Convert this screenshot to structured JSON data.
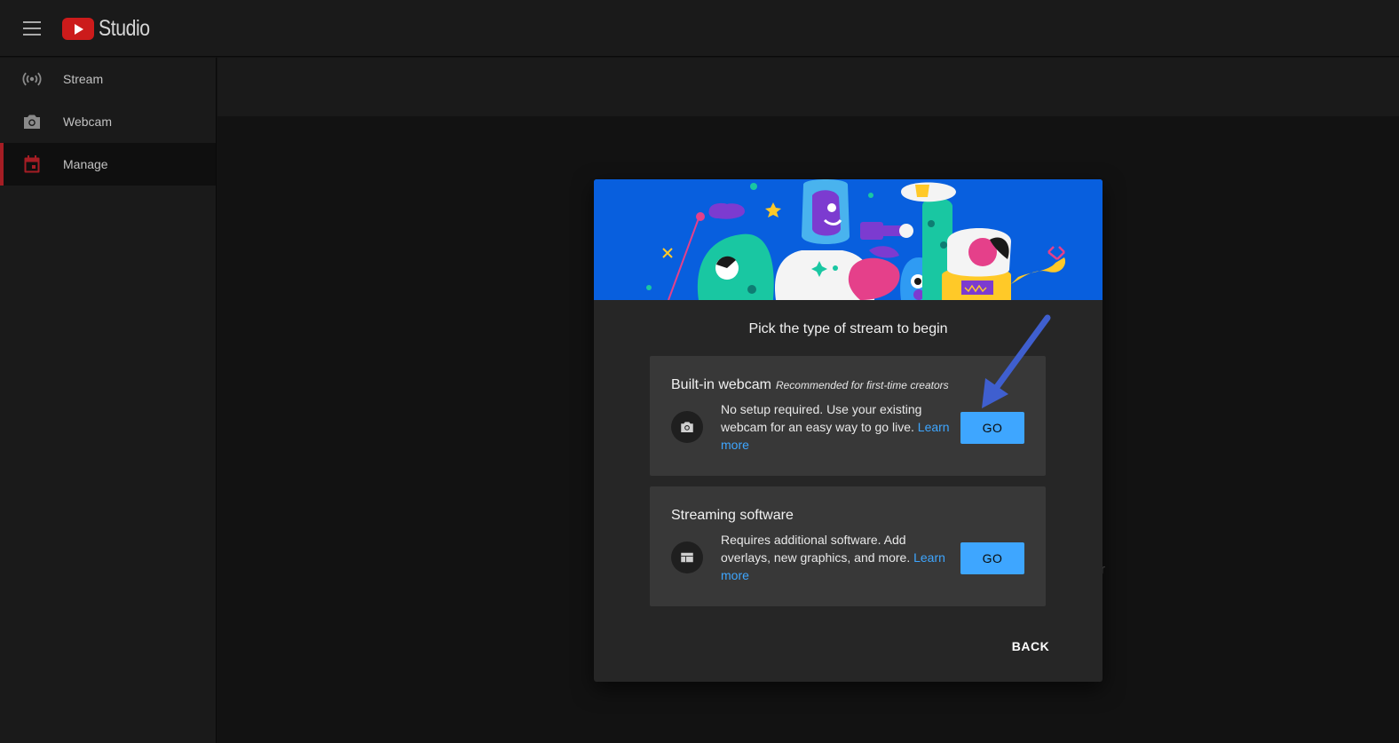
{
  "app": {
    "logo_text": "Studio",
    "brand_color": "#cc1b1b"
  },
  "sidebar": {
    "items": [
      {
        "label": "Stream",
        "icon": "broadcast-icon",
        "active": false
      },
      {
        "label": "Webcam",
        "icon": "camera-icon",
        "active": false
      },
      {
        "label": "Manage",
        "icon": "calendar-icon",
        "active": true
      }
    ],
    "active_color": "#a51d24"
  },
  "main": {
    "stray_char": "r"
  },
  "dialog": {
    "title": "Pick the type of stream to begin",
    "options": [
      {
        "title": "Built-in webcam",
        "badge": "Recommended for first-time creators",
        "icon": "camera-icon",
        "description": "No setup required. Use your existing webcam for an easy way to go live.",
        "link": "Learn more",
        "button": "GO"
      },
      {
        "title": "Streaming software",
        "badge": "",
        "icon": "software-layout-icon",
        "description": "Requires additional software. Add overlays, new graphics, and more.",
        "link": "Learn more",
        "button": "GO"
      }
    ],
    "back_label": "BACK",
    "accent_color": "#3ea6ff",
    "banner_color": "#085fde"
  },
  "annotation": {
    "arrow_color": "#3f5fcf",
    "icon": "pointer-arrow-icon"
  }
}
